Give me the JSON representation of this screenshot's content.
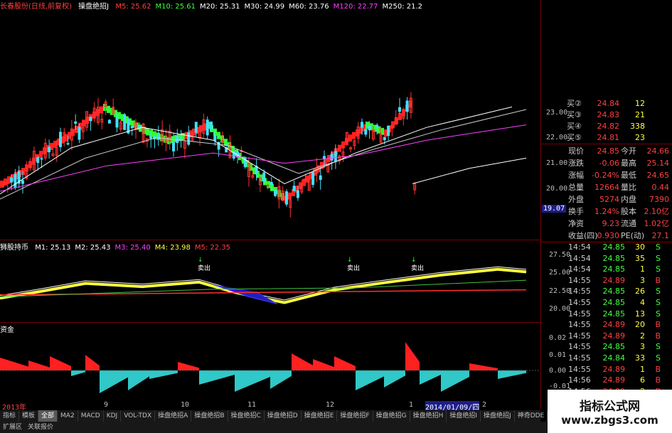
{
  "header": {
    "stock": "长春股份(日线,前复权)",
    "indicator": "操盘绝招J",
    "ma": [
      {
        "label": "M5: 25.62",
        "color": "#ff4040"
      },
      {
        "label": "M10: 25.61",
        "color": "#40ff40"
      },
      {
        "label": "M20: 25.31",
        "color": "#ffffff"
      },
      {
        "label": "M30: 24.99",
        "color": "#ffffff"
      },
      {
        "label": "M60: 23.76",
        "color": "#ffffff"
      },
      {
        "label": "M120: 22.77",
        "color": "#ff40ff"
      },
      {
        "label": "M250: 21.2",
        "color": "#ffffff"
      }
    ]
  },
  "price_axis": [
    "23.00",
    "22.00",
    "21.00",
    "20.00",
    "19.07"
  ],
  "sub1": {
    "title": "狮股持币",
    "ma": [
      {
        "label": "M1: 25.13",
        "color": "#ffffff"
      },
      {
        "label": "M2: 25.43",
        "color": "#ffffff"
      },
      {
        "label": "M3: 25.40",
        "color": "#ff40ff"
      },
      {
        "label": "M4: 23.98",
        "color": "#ffff40"
      },
      {
        "label": "M5: 22.35",
        "color": "#ff4040"
      }
    ],
    "axis": [
      "27.50",
      "25.00",
      "22.50",
      "20.00"
    ],
    "signals": [
      "卖出",
      "卖出",
      "卖出",
      "卖出"
    ]
  },
  "sub2": {
    "title": "资金",
    "axis": [
      "0.02",
      "0.01",
      "0.00",
      "-0.01"
    ]
  },
  "x_labels": [
    "2013年",
    "9",
    "10",
    "11",
    "12",
    "1",
    "2014/01/09/四",
    "2"
  ],
  "quotes": [
    {
      "label": "买②",
      "price": "24.84",
      "vol": "12"
    },
    {
      "label": "买③",
      "price": "24.83",
      "vol": "21"
    },
    {
      "label": "买④",
      "price": "24.82",
      "vol": "338"
    },
    {
      "label": "买⑤",
      "price": "24.81",
      "vol": "23"
    }
  ],
  "stats": [
    {
      "l1": "现价",
      "v1": "24.85",
      "l2": "今开",
      "v2": "24.66"
    },
    {
      "l1": "涨跌",
      "v1": "-0.06",
      "l2": "最高",
      "v2": "25.14"
    },
    {
      "l1": "涨幅",
      "v1": "-0.24%",
      "l2": "最低",
      "v2": "24.65"
    },
    {
      "l1": "总量",
      "v1": "12664",
      "l2": "量比",
      "v2": "0.44"
    },
    {
      "l1": "外盘",
      "v1": "5274",
      "l2": "内盘",
      "v2": "7390"
    },
    {
      "l1": "换手",
      "v1": "1.24%",
      "l2": "股本",
      "v2": "2.10亿"
    },
    {
      "l1": "净资",
      "v1": "9.23",
      "l2": "流通",
      "v2": "1.02亿"
    },
    {
      "l1": "收益(四)",
      "v1": "0.930",
      "l2": "PE(动)",
      "v2": "27.1"
    }
  ],
  "ticks": [
    {
      "t": "14:54",
      "p": "24.85",
      "vol": "30",
      "bs": "S",
      "c": "#40ff40"
    },
    {
      "t": "14:54",
      "p": "24.85",
      "vol": "35",
      "bs": "S",
      "c": "#40ff40"
    },
    {
      "t": "14:54",
      "p": "24.85",
      "vol": "1",
      "bs": "S",
      "c": "#40ff40"
    },
    {
      "t": "14:55",
      "p": "24.89",
      "vol": "3",
      "bs": "B",
      "c": "#ff4040"
    },
    {
      "t": "14:55",
      "p": "24.85",
      "vol": "26",
      "bs": "S",
      "c": "#40ff40"
    },
    {
      "t": "14:55",
      "p": "24.85",
      "vol": "4",
      "bs": "S",
      "c": "#40ff40"
    },
    {
      "t": "14:55",
      "p": "24.85",
      "vol": "13",
      "bs": "S",
      "c": "#40ff40"
    },
    {
      "t": "14:55",
      "p": "24.89",
      "vol": "20",
      "bs": "B",
      "c": "#ff4040"
    },
    {
      "t": "14:55",
      "p": "24.89",
      "vol": "2",
      "bs": "B",
      "c": "#ff4040"
    },
    {
      "t": "14:55",
      "p": "24.85",
      "vol": "3",
      "bs": "S",
      "c": "#40ff40"
    },
    {
      "t": "14:55",
      "p": "24.84",
      "vol": "33",
      "bs": "S",
      "c": "#40ff40"
    },
    {
      "t": "14:55",
      "p": "24.89",
      "vol": "1",
      "bs": "B",
      "c": "#ff4040"
    },
    {
      "t": "14:56",
      "p": "24.89",
      "vol": "6",
      "bs": "B",
      "c": "#ff4040"
    },
    {
      "t": "14:56",
      "p": "24.89",
      "vol": "2",
      "bs": "B",
      "c": "#ff4040"
    },
    {
      "t": "14:56",
      "p": "24.85",
      "vol": "1",
      "bs": "S",
      "c": "#40ff40"
    },
    {
      "t": "14:56",
      "p": "24.87",
      "vol": "1",
      "bs": "B",
      "c": "#ff4040"
    },
    {
      "t": "14:56",
      "p": "24.87",
      "vol": "2",
      "bs": "B",
      "c": "#ff4040"
    }
  ],
  "tabs": [
    "指标",
    "模板",
    "全部",
    "MA2",
    "MACD",
    "KDJ",
    "VOL-TDX",
    "操盘绝招A",
    "操盘绝招B",
    "操盘绝招C",
    "操盘绝招D",
    "操盘绝招E",
    "操盘绝招F",
    "操盘绝招G",
    "操盘绝招H",
    "操盘绝招I",
    "操盘绝招J",
    "神奇DDE",
    "资",
    "控",
    "布",
    "BSI"
  ],
  "bottom_tabs": [
    "扩展区",
    "关联报价"
  ],
  "watermark": {
    "line1": "指标公式网",
    "line2": "www.zbgs3.com"
  }
}
